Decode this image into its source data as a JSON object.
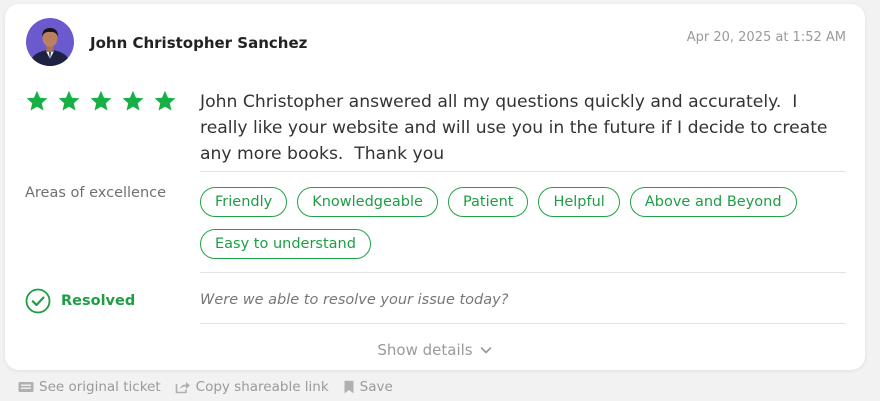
{
  "review": {
    "reviewer_name": "John Christopher Sanchez",
    "timestamp": "Apr 20, 2025 at 1:52 AM",
    "rating": 5,
    "rating_max": 5,
    "text": "John Christopher answered all my questions quickly and accurately.  I really like your website and will use you in the future if I decide to create any more books.  Thank you",
    "areas_label": "Areas of excellence",
    "tags": [
      "Friendly",
      "Knowledgeable",
      "Patient",
      "Helpful",
      "Above and Beyond",
      "Easy to understand"
    ],
    "resolved_label": "Resolved",
    "resolution_question": "Were we able to resolve your issue today?",
    "show_details_label": "Show details"
  },
  "footer": {
    "see_ticket_label": "See original ticket",
    "copy_link_label": "Copy shareable link",
    "save_label": "Save"
  },
  "colors": {
    "accent_green": "#1e9e44",
    "star_green": "#17b046",
    "muted_gray": "#9a9a9a",
    "avatar_bg": "#6a5acd"
  },
  "icons": {
    "star": "star-icon",
    "resolved": "check-circle-icon",
    "show_details": "chevron-down-icon",
    "ticket": "ticket-icon",
    "share": "share-icon",
    "save": "bookmark-icon"
  }
}
